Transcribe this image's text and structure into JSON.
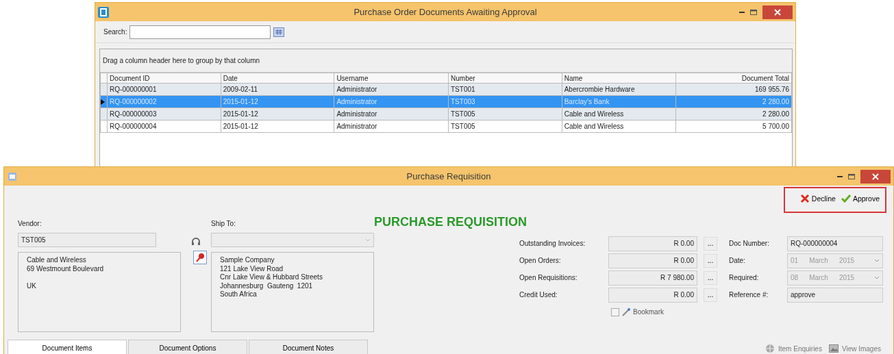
{
  "po_window": {
    "title": "Purchase Order Documents Awaiting Approval",
    "search": {
      "label": "Search:"
    },
    "group_hint": "Drag a column header here to group by that column",
    "table": {
      "columns": [
        "Document ID",
        "Date",
        "Username",
        "Number",
        "Name",
        "Document Total"
      ],
      "rows": [
        {
          "cells": [
            "RQ-000000001",
            "2009-02-11",
            "Administrator",
            "TST001",
            "Abercrombie Hardware",
            "169 955.76"
          ],
          "selected": false
        },
        {
          "cells": [
            "RQ-000000002",
            "2015-01-12",
            "Administrator",
            "TST003",
            "Barclay's Bank",
            "2 280.00"
          ],
          "selected": true
        },
        {
          "cells": [
            "RQ-000000003",
            "2015-01-12",
            "Administrator",
            "TST005",
            "Cable and Wireless",
            "2 280.00"
          ],
          "selected": false
        },
        {
          "cells": [
            "RQ-000000004",
            "2015-01-12",
            "Administrator",
            "TST005",
            "Cable and Wireless",
            "5 700.00"
          ],
          "selected": false
        }
      ]
    }
  },
  "requisition_window": {
    "title": "Purchase Requisition",
    "actions": [
      {
        "label": "Decline",
        "kind": "decline"
      },
      {
        "label": "Approve",
        "kind": "approve"
      }
    ],
    "heading": "PURCHASE REQUISITION",
    "vendor": {
      "label": "Vendor:",
      "code": "TST005",
      "address": "Cable and Wireless\n69 Westmount Boulevard\n\nUK"
    },
    "ship_to": {
      "label": "Ship To:",
      "address": "Sample Company\n121 Lake View Road\nCnr Lake View & Hubbard Streets\nJohannesburg  Gauteng  1201\nSouth Africa"
    },
    "balances": [
      {
        "label": "Outstanding Invoices:",
        "value": "R 0.00",
        "button": "..."
      },
      {
        "label": "Open Orders:",
        "value": "R 0.00",
        "button": "..."
      },
      {
        "label": "Open Requisitions:",
        "value": "R 7 980.00",
        "button": "..."
      },
      {
        "label": "Credit Used:",
        "value": "R 0.00",
        "button": "..."
      }
    ],
    "doc_fields": [
      {
        "label": "Doc Number:",
        "kind": "text",
        "value": "RQ-000000004",
        "disabled": false
      },
      {
        "label": "Date:",
        "kind": "date",
        "parts": [
          "01",
          "March",
          "2015"
        ],
        "disabled": true
      },
      {
        "label": "Required:",
        "kind": "date",
        "parts": [
          "08",
          "March",
          "2015"
        ],
        "disabled": true
      },
      {
        "label": "Reference #:",
        "kind": "text",
        "value": "approve",
        "disabled": false
      }
    ],
    "bookmark": {
      "label": "Bookmark",
      "checked": false
    },
    "tabs": [
      {
        "label": "Document Items",
        "selected": true
      },
      {
        "label": "Document Options",
        "selected": false
      },
      {
        "label": "Document Notes",
        "selected": false
      }
    ],
    "tools": [
      {
        "label": "Item Enquiries",
        "kind": "enquiries"
      },
      {
        "label": "View Images",
        "kind": "images"
      }
    ]
  }
}
